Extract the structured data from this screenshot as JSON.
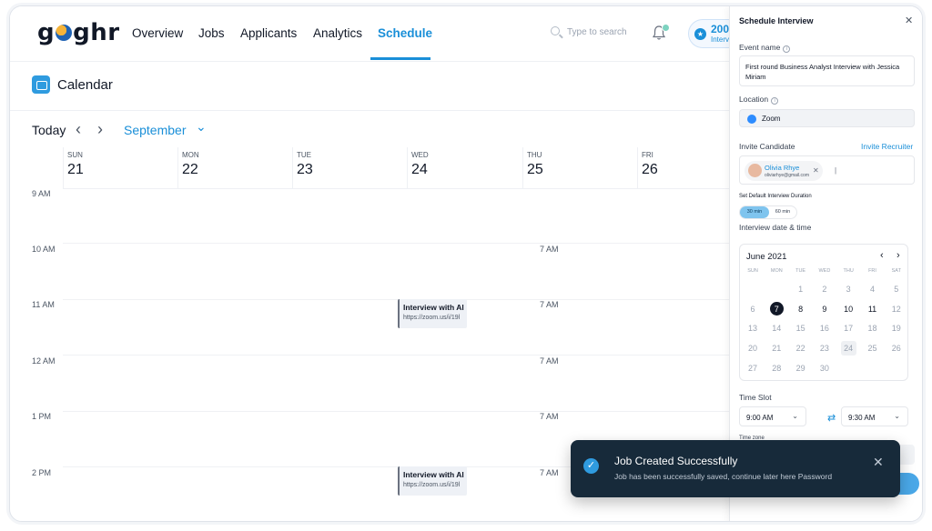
{
  "app": {
    "logo": "goghr"
  },
  "nav": {
    "items": [
      {
        "label": "Overview",
        "active": false
      },
      {
        "label": "Jobs",
        "active": false
      },
      {
        "label": "Applicants",
        "active": false
      },
      {
        "label": "Analytics",
        "active": false
      },
      {
        "label": "Schedule",
        "active": true
      }
    ],
    "search_placeholder": "Type to search",
    "bell_badge": "1",
    "points_value": "200",
    "points_label": "Interv"
  },
  "calendar": {
    "title": "Calendar",
    "today_label": "Today",
    "month_label": "September",
    "days": [
      {
        "name": "SUN",
        "date": "21"
      },
      {
        "name": "MON",
        "date": "22"
      },
      {
        "name": "TUE",
        "date": "23"
      },
      {
        "name": "WED",
        "date": "24"
      },
      {
        "name": "THU",
        "date": "25"
      },
      {
        "name": "FRI",
        "date": "26"
      }
    ],
    "hours": [
      "9 AM",
      "10 AM",
      "11 AM",
      "12 AM",
      "1 PM",
      "2 PM"
    ],
    "thu_labels": [
      "7 AM",
      "7 AM",
      "7 AM",
      "7 AM",
      "7 AM"
    ],
    "events": [
      {
        "title": "Interview with Al",
        "url": "https://zoom.us/i/19l"
      },
      {
        "title": "Interview with Al",
        "url": "https://zoom.us/i/19l"
      }
    ]
  },
  "panel": {
    "title": "Schedule Interview",
    "event_name_label": "Event name",
    "event_name_value": "First round Business Analyst Interview with Jessica Miriam",
    "location_label": "Location",
    "location_value": "Zoom",
    "invite_candidate_label": "Invite Candidate",
    "invite_recruiter_label": "Invite Recruiter",
    "candidate_name": "Olivia Rhye",
    "candidate_email": "oliviarhye@gmail.com",
    "duration_label": "Set Default Interview Duration",
    "duration_options": [
      "30 min",
      "60 min"
    ],
    "datetime_label": "Interview date & time",
    "month_title": "June 2021",
    "dow": [
      "SUN",
      "MON",
      "TUE",
      "WED",
      "THU",
      "FRI",
      "SAT"
    ],
    "weeks": [
      [
        "",
        "",
        "1",
        "2",
        "3",
        "4",
        "5"
      ],
      [
        "6",
        "7",
        "8",
        "9",
        "10",
        "11",
        "12"
      ],
      [
        "13",
        "14",
        "15",
        "16",
        "17",
        "18",
        "19"
      ],
      [
        "20",
        "21",
        "22",
        "23",
        "24",
        "25",
        "26"
      ],
      [
        "27",
        "28",
        "29",
        "30",
        "",
        "",
        ""
      ]
    ],
    "selected_day": "7",
    "today_day": "24",
    "current_days": [
      "8",
      "9",
      "10",
      "11"
    ],
    "time_slot_label": "Time Slot",
    "time_from": "9:00 AM",
    "time_to": "9:30 AM",
    "time_zone_label": "Time zone"
  },
  "toast": {
    "title": "Job Created Successfully",
    "description": "Job has been successfully saved, continue later here Password"
  }
}
